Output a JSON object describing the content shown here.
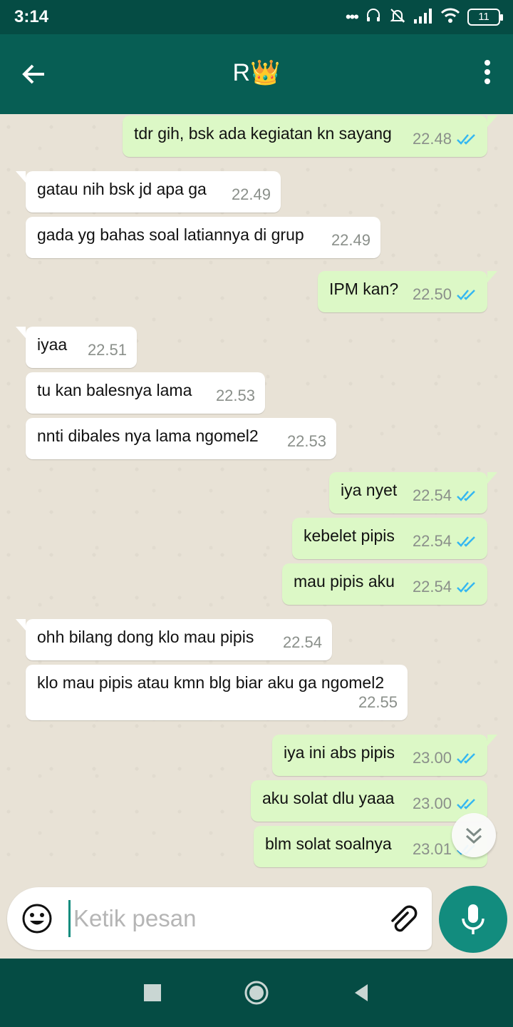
{
  "status_bar": {
    "time": "3:14",
    "battery": "11"
  },
  "header": {
    "contact_name": "R👑"
  },
  "messages": [
    {
      "dir": "out",
      "text": "tdr gih, bsk ada kegiatan kn sayang",
      "time": "22.48"
    },
    {
      "dir": "in",
      "text": "gatau nih bsk jd apa ga",
      "time": "22.49"
    },
    {
      "dir": "in",
      "text": "gada yg bahas soal latiannya di grup",
      "time": "22.49"
    },
    {
      "dir": "out",
      "text": "IPM kan?",
      "time": "22.50"
    },
    {
      "dir": "in",
      "text": "iyaa",
      "time": "22.51"
    },
    {
      "dir": "in",
      "text": "tu kan balesnya lama",
      "time": "22.53"
    },
    {
      "dir": "in",
      "text": "nnti dibales nya lama ngomel2",
      "time": "22.53"
    },
    {
      "dir": "out",
      "text": "iya nyet",
      "time": "22.54"
    },
    {
      "dir": "out",
      "text": "kebelet pipis",
      "time": "22.54"
    },
    {
      "dir": "out",
      "text": "mau pipis aku",
      "time": "22.54"
    },
    {
      "dir": "in",
      "text": "ohh bilang dong klo mau pipis",
      "time": "22.54"
    },
    {
      "dir": "in",
      "text": "klo mau pipis atau kmn blg biar aku ga ngomel2",
      "time": "22.55"
    },
    {
      "dir": "out",
      "text": "iya ini abs pipis",
      "time": "23.00"
    },
    {
      "dir": "out",
      "text": "aku solat dlu yaaa",
      "time": "23.00"
    },
    {
      "dir": "out",
      "text": "blm solat soalnya",
      "time": "23.01"
    }
  ],
  "composer": {
    "placeholder": "Ketik pesan"
  },
  "icons": {
    "back": "arrow-left-icon",
    "menu": "more-vert-icon",
    "emoji": "emoji-icon",
    "attach": "paperclip-icon",
    "mic": "mic-icon",
    "read_receipt": "double-check-icon",
    "scroll": "chevron-double-down-icon"
  },
  "colors": {
    "header": "#075e54",
    "status": "#054c44",
    "outgoing": "#dcf8c6",
    "incoming": "#ffffff",
    "tick": "#34b7f1",
    "accent": "#128c7e"
  }
}
